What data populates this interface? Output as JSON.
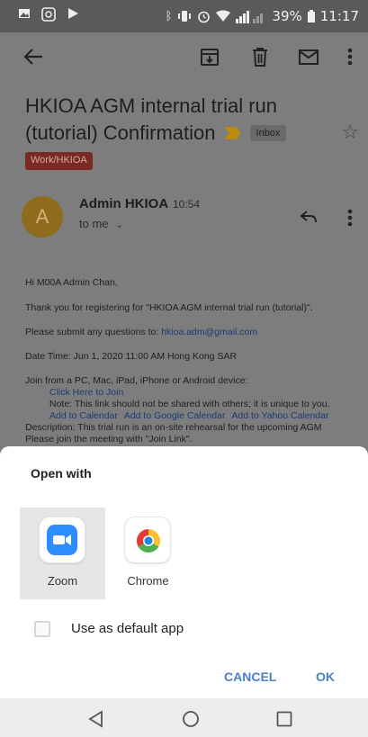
{
  "status_bar": {
    "battery": "39%",
    "time": "11:17",
    "left_icons": [
      "image-icon",
      "e-icon",
      "play-icon"
    ],
    "right_icons": [
      "bluetooth-icon",
      "vibrate-icon",
      "alarm-icon",
      "wifi-icon",
      "signal-icon",
      "battery-icon"
    ]
  },
  "email": {
    "subject_line1": "HKIOA AGM internal trial run",
    "subject_line2": "(tutorial) Confirmation",
    "folder_badge": "Inbox",
    "label_chip": "Work/HKIOA",
    "avatar_letter": "A",
    "sender": "Admin HKIOA",
    "time": "10:54",
    "to": "to me",
    "body": {
      "greeting": "Hi M00A Admin Chan,",
      "thanks": "Thank you for registering for \"HKIOA AGM internal trial run (tutorial)\".",
      "questions_prefix": "Please submit any questions to:",
      "questions_email": "hkioa.adm@gmail.com",
      "datetime": "Date Time: Jun 1, 2020 11:00 AM Hong Kong SAR",
      "join_from": "Join from a PC, Mac, iPad, iPhone or Android device:",
      "click_to_join": "Click Here to Join",
      "note": "Note: This link should not be shared with others; it is unique to you.",
      "add_calendar": "Add to Calendar",
      "add_google": "Add to Google Calendar",
      "add_yahoo": "Add to Yahoo Calendar",
      "description": "Description: This trial run is an on-site rehearsal for the upcoming AGM",
      "please_join": "Please join the meeting with \"Join Link\"."
    }
  },
  "open_with": {
    "title": "Open with",
    "apps": [
      {
        "label": "Zoom",
        "selected": true
      },
      {
        "label": "Chrome",
        "selected": false
      }
    ],
    "default_label": "Use as default app",
    "default_checked": false,
    "cancel": "CANCEL",
    "ok": "OK"
  },
  "colors": {
    "accent": "#4a80c8",
    "zoom_blue": "#2d8cff"
  }
}
